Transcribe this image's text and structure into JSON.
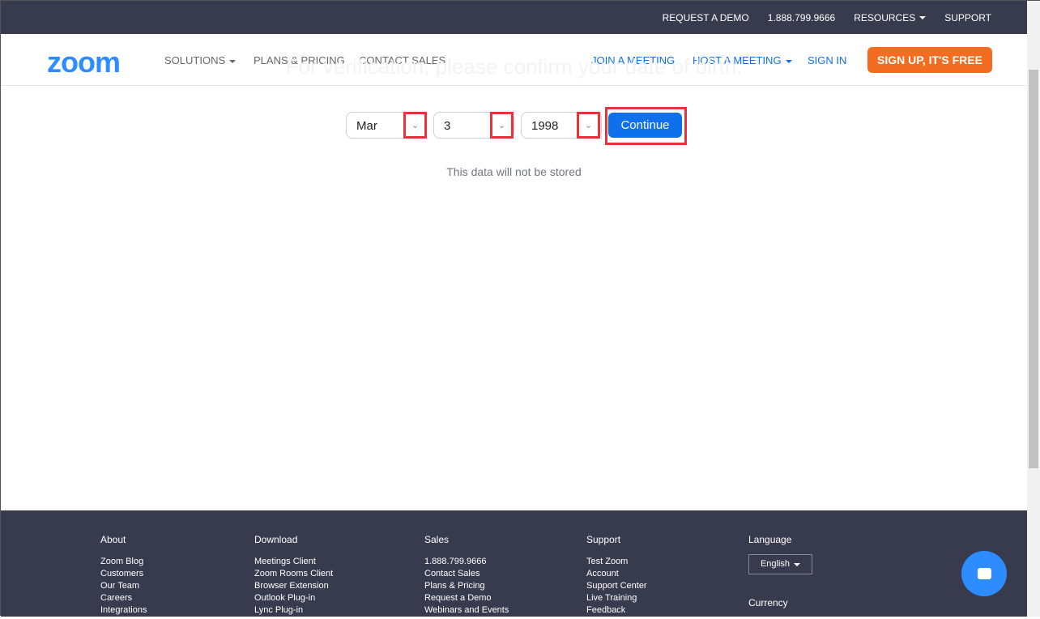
{
  "topbar": {
    "items": [
      "REQUEST A DEMO",
      "1.888.799.9666",
      "RESOURCES",
      "SUPPORT"
    ]
  },
  "header": {
    "logo": "zoom",
    "nav_left": [
      "SOLUTIONS",
      "PLANS & PRICING",
      "CONTACT SALES"
    ],
    "nav_right": [
      "JOIN A MEETING",
      "HOST A MEETING",
      "SIGN IN"
    ],
    "signup": "SIGN UP, IT'S FREE"
  },
  "main": {
    "heading": "For verification, please confirm your date of birth.",
    "month": "Mar",
    "day": "3",
    "year": "1998",
    "continue": "Continue",
    "note": "This data will not be stored"
  },
  "footer": {
    "columns": [
      {
        "title": "About",
        "links": [
          "Zoom Blog",
          "Customers",
          "Our Team",
          "Careers",
          "Integrations"
        ]
      },
      {
        "title": "Download",
        "links": [
          "Meetings Client",
          "Zoom Rooms Client",
          "Browser Extension",
          "Outlook Plug-in",
          "Lync Plug-in"
        ]
      },
      {
        "title": "Sales",
        "links": [
          "1.888.799.9666",
          "Contact Sales",
          "Plans & Pricing",
          "Request a Demo",
          "Webinars and Events"
        ]
      },
      {
        "title": "Support",
        "links": [
          "Test Zoom",
          "Account",
          "Support Center",
          "Live Training",
          "Feedback"
        ]
      }
    ],
    "language_title": "Language",
    "language": "English",
    "currency_title": "Currency"
  },
  "colors": {
    "accent": "#0e71eb",
    "signup": "#f26d21",
    "dark": "#383a4e",
    "highlight": "#e8333d"
  }
}
